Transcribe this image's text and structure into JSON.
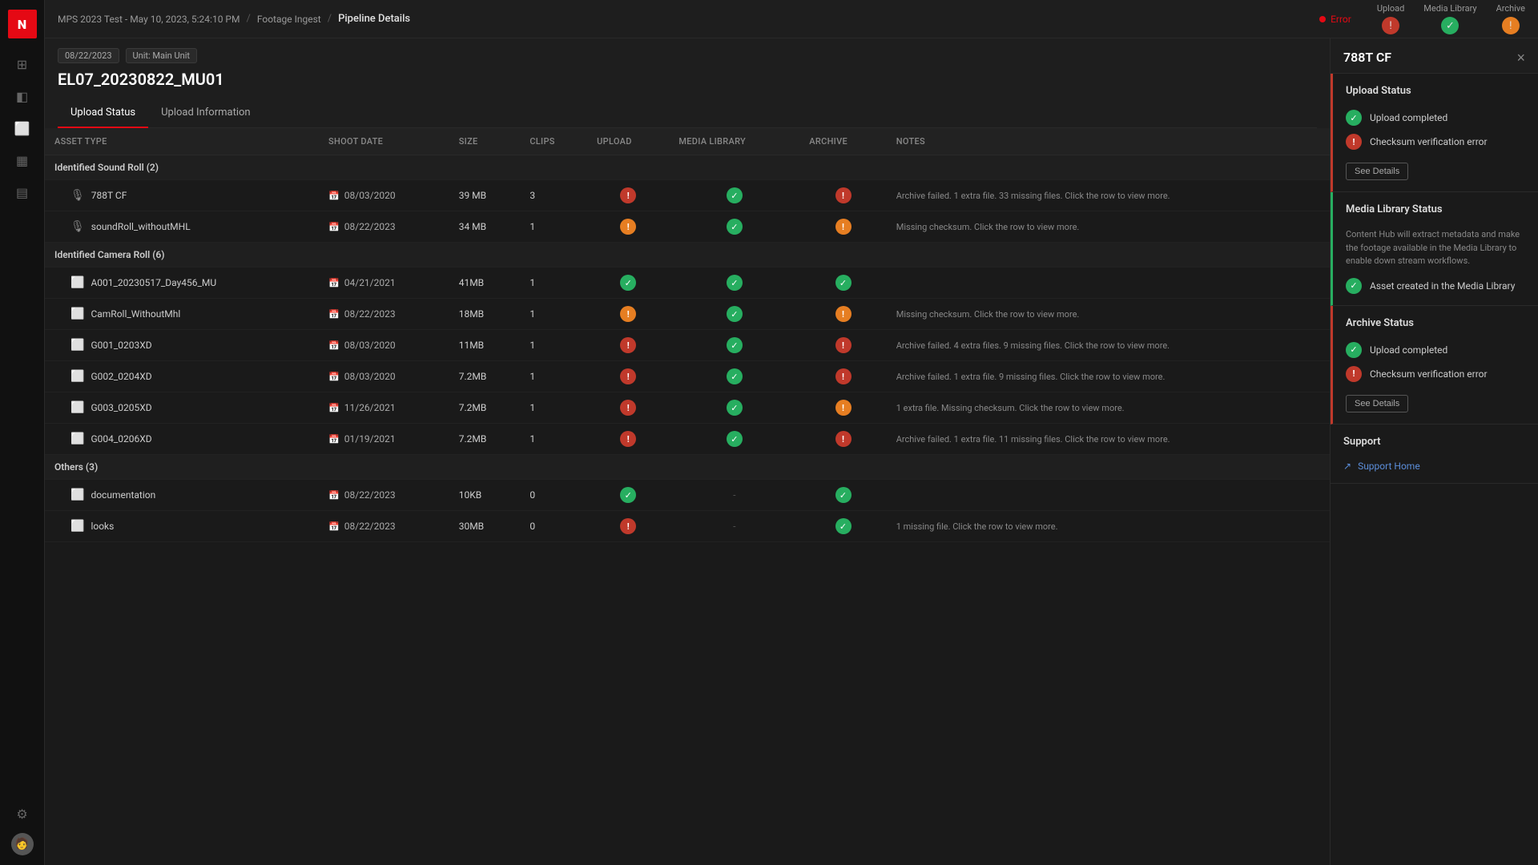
{
  "app": {
    "logo": "N",
    "logo_bg": "#e50914"
  },
  "topbar": {
    "breadcrumb": [
      {
        "label": "MPS 2023 Test - May 10, 2023, 5:24:10 PM",
        "active": false
      },
      {
        "label": "Footage Ingest",
        "active": false
      },
      {
        "label": "Pipeline Details",
        "active": true
      }
    ],
    "error_label": "Error",
    "pipeline_stages": [
      {
        "label": "Upload",
        "status": "red"
      },
      {
        "label": "Media Library",
        "status": "green"
      },
      {
        "label": "Archive",
        "status": "orange"
      }
    ]
  },
  "page": {
    "tags": [
      "08/22/2023",
      "Unit: Main Unit"
    ],
    "title": "EL07_20230822_MU01",
    "error_text": "Error",
    "tabs": [
      "Upload Status",
      "Upload Information"
    ]
  },
  "table": {
    "columns": [
      "Asset Type",
      "Shoot Date",
      "Size",
      "Clips",
      "Upload",
      "Media Library",
      "Archive",
      "Notes"
    ],
    "groups": [
      {
        "label": "Identified Sound Roll (2)",
        "rows": [
          {
            "icon": "mic",
            "name": "788T CF",
            "date": "08/03/2020",
            "size": "39 MB",
            "clips": "3",
            "upload": "warn-red",
            "media_library": "check-green",
            "archive": "warn-red",
            "notes": "Archive failed. 1 extra file. 33 missing files. Click the row to view more."
          },
          {
            "icon": "mic",
            "name": "soundRoll_withoutMHL",
            "date": "08/22/2023",
            "size": "34 MB",
            "clips": "1",
            "upload": "warn-orange",
            "media_library": "check-green",
            "archive": "warn-orange",
            "notes": "Missing checksum. Click the row to view more."
          }
        ]
      },
      {
        "label": "Identified Camera Roll (6)",
        "rows": [
          {
            "icon": "folder",
            "name": "A001_20230517_Day456_MU",
            "date": "04/21/2021",
            "size": "41MB",
            "clips": "1",
            "upload": "check-green",
            "media_library": "check-green",
            "archive": "check-green",
            "notes": ""
          },
          {
            "icon": "folder",
            "name": "CamRoll_WithoutMhl",
            "date": "08/22/2023",
            "size": "18MB",
            "clips": "1",
            "upload": "warn-orange",
            "media_library": "check-green",
            "archive": "warn-orange",
            "notes": "Missing checksum. Click the row to view more."
          },
          {
            "icon": "folder",
            "name": "G001_0203XD",
            "date": "08/03/2020",
            "size": "11MB",
            "clips": "1",
            "upload": "warn-red",
            "media_library": "check-green",
            "archive": "warn-red",
            "notes": "Archive failed. 4 extra files. 9 missing files. Click the row to view more."
          },
          {
            "icon": "folder",
            "name": "G002_0204XD",
            "date": "08/03/2020",
            "size": "7.2MB",
            "clips": "1",
            "upload": "warn-red",
            "media_library": "check-green",
            "archive": "warn-red",
            "notes": "Archive failed. 1 extra file. 9 missing files. Click the row to view more."
          },
          {
            "icon": "folder",
            "name": "G003_0205XD",
            "date": "11/26/2021",
            "size": "7.2MB",
            "clips": "1",
            "upload": "warn-red",
            "media_library": "check-green",
            "archive": "warn-orange",
            "notes": "1 extra file. Missing checksum. Click the row to view more."
          },
          {
            "icon": "folder",
            "name": "G004_0206XD",
            "date": "01/19/2021",
            "size": "7.2MB",
            "clips": "1",
            "upload": "warn-red",
            "media_library": "check-green",
            "archive": "warn-red",
            "notes": "Archive failed. 1 extra file. 11 missing files. Click the row to view more."
          }
        ]
      },
      {
        "label": "Others (3)",
        "rows": [
          {
            "icon": "folder",
            "name": "documentation",
            "date": "08/22/2023",
            "size": "10KB",
            "clips": "0",
            "upload": "check-green",
            "media_library": "dash",
            "archive": "check-green",
            "notes": ""
          },
          {
            "icon": "folder",
            "name": "looks",
            "date": "08/22/2023",
            "size": "30MB",
            "clips": "0",
            "upload": "warn-red",
            "media_library": "dash",
            "archive": "check-green",
            "notes": "1 missing file. Click the row to view more."
          }
        ]
      }
    ]
  },
  "right_panel": {
    "title": "788T CF",
    "close_label": "×",
    "upload_status": {
      "section_title": "Upload Status",
      "items": [
        {
          "type": "check-green",
          "label": "Upload completed"
        },
        {
          "type": "warn-red",
          "label": "Checksum verification error"
        }
      ],
      "see_details_label": "See Details"
    },
    "media_library_status": {
      "section_title": "Media Library Status",
      "description": "Content Hub will extract metadata and make the footage available in the Media Library to enable down stream workflows.",
      "items": [
        {
          "type": "check-green",
          "label": "Asset created in the Media Library"
        }
      ]
    },
    "archive_status": {
      "section_title": "Archive Status",
      "items": [
        {
          "type": "check-green",
          "label": "Upload completed"
        },
        {
          "type": "warn-red",
          "label": "Checksum verification error"
        }
      ],
      "see_details_label": "See Details"
    },
    "support": {
      "section_title": "Support",
      "support_home_label": "Support Home"
    }
  },
  "sidebar": {
    "icons": [
      {
        "name": "grid-icon",
        "symbol": "⊞",
        "active": false
      },
      {
        "name": "layers-icon",
        "symbol": "◫",
        "active": false
      },
      {
        "name": "folder-icon",
        "symbol": "🗂",
        "active": false
      },
      {
        "name": "film-icon",
        "symbol": "🎞",
        "active": false
      },
      {
        "name": "chart-icon",
        "symbol": "📊",
        "active": false
      },
      {
        "name": "settings-icon",
        "symbol": "⚙",
        "active": false
      }
    ]
  }
}
